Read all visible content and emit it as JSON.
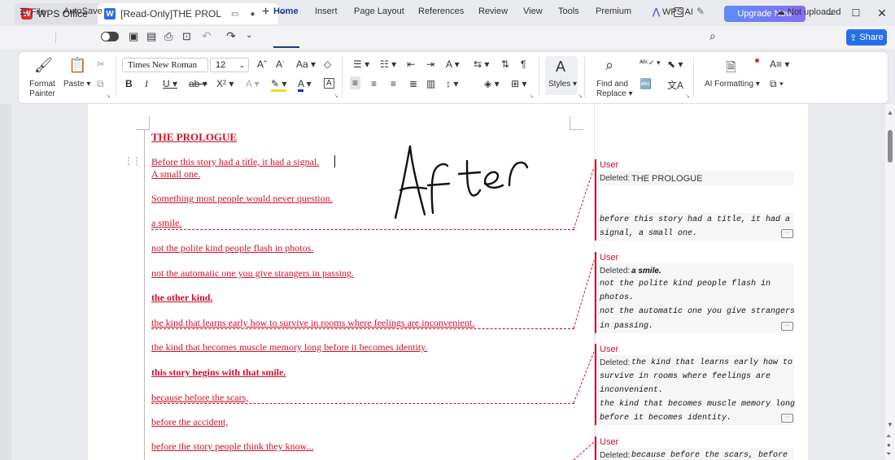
{
  "tabs": {
    "app_label": "WPS Office",
    "doc_label": "[Read-Only]THE PROLOGUE"
  },
  "titlebar": {
    "upgrade_label": "Upgrade Now"
  },
  "menu": {
    "file": "File",
    "autosave": "AutoSave",
    "items": [
      "Home",
      "Insert",
      "Page Layout",
      "References",
      "Review",
      "View",
      "Tools",
      "Premium"
    ],
    "wps_ai": "WPS AI",
    "not_uploaded": "Not uploaded",
    "share": "Share"
  },
  "ribbon": {
    "format_painter": "Format Painter",
    "paste": "Paste",
    "font_name": "Times New Roman",
    "font_size": "12",
    "styles": "Styles",
    "find_replace": "Find and Replace",
    "ai_formatting": "AI Formatting"
  },
  "document": {
    "handwriting": "After",
    "lines": [
      "THE PROLOGUE",
      "Before this story had a title, it had a signal.",
      "A small one.",
      "Something most people would never question.",
      "a smile.",
      "not the polite kind people flash in photos.",
      "not the automatic one you give strangers in passing.",
      "the other kind.",
      "the kind that learns early how to survive in rooms where feelings are inconvenient.",
      "the kind that becomes muscle memory long before it becomes identity.",
      "this story begins with that smile.",
      "because before the scars,",
      "before the accident,",
      "before the story people think they know..."
    ]
  },
  "comments": [
    {
      "author": "User",
      "deleted_label": "Deleted:",
      "deleted_text": "THE PROLOGUE",
      "lines": [
        "before this story had a title, it had a",
        "signal, a small one."
      ]
    },
    {
      "author": "User",
      "deleted_label": "Deleted:",
      "deleted_text": "a smile.",
      "lines": [
        "not the polite kind people flash in",
        "photos.",
        "not the automatic one you give strangers",
        "in passing."
      ]
    },
    {
      "author": "User",
      "deleted_label": "Deleted:",
      "lines": [
        "the kind that learns early how to",
        "survive in rooms where feelings are",
        "inconvenient.",
        "the kind that becomes muscle memory long",
        "before it becomes identity."
      ]
    },
    {
      "author": "User",
      "deleted_label": "Deleted:",
      "lines": [
        "because before the scars, before"
      ]
    }
  ],
  "colors": {
    "accent": "#2570e8",
    "revision_red": "#d0102a",
    "wps_red": "#e0282a"
  }
}
